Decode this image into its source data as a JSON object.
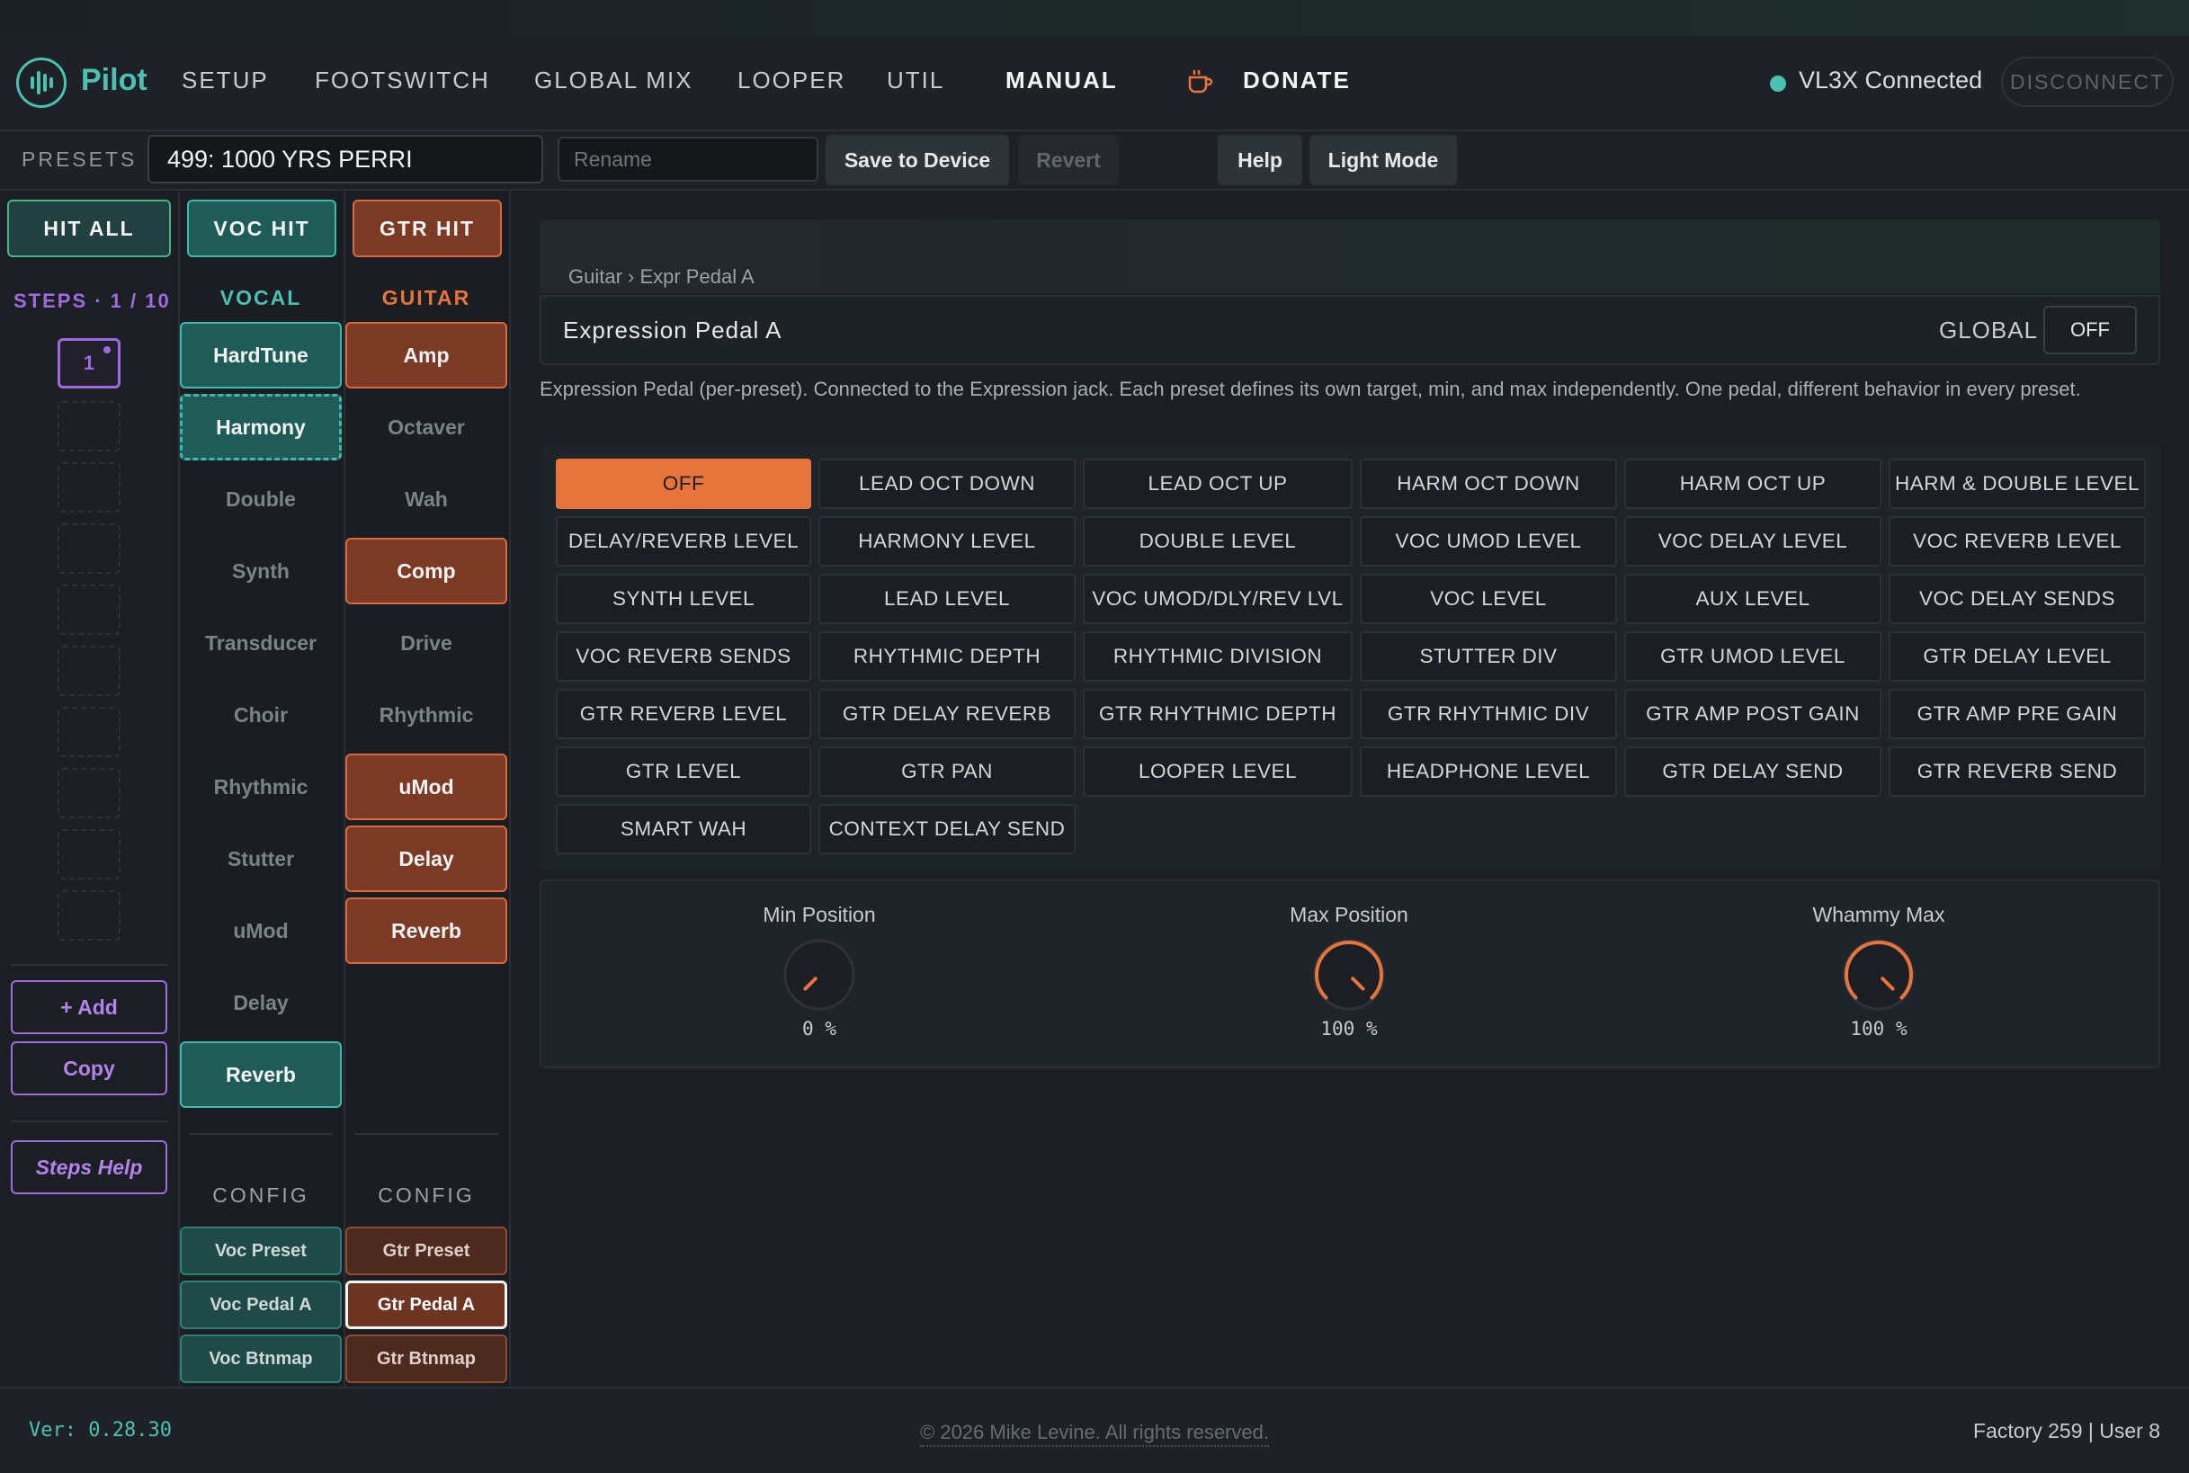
{
  "nav": {
    "brand": "Pilot",
    "items": [
      "SETUP",
      "FOOTSWITCH",
      "GLOBAL MIX",
      "LOOPER",
      "UTIL",
      "MANUAL"
    ],
    "donate": "DONATE",
    "connection_status": "VL3X Connected",
    "disconnect_label": "DISCONNECT"
  },
  "presets": {
    "label": "PRESETS",
    "current": "499: 1000 YRS PERRI",
    "rename_placeholder": "Rename",
    "save_label": "Save to Device",
    "revert_label": "Revert",
    "help_label": "Help",
    "light_mode_label": "Light Mode"
  },
  "steps": {
    "hit_all": "HIT ALL",
    "voc_hit": "VOC HIT",
    "gtr_hit": "GTR HIT",
    "title": "STEPS · 1 / 10",
    "active_step": "1",
    "add_label": "+ Add",
    "copy_label": "Copy",
    "help_label": "Steps Help"
  },
  "vocal": {
    "header": "VOCAL",
    "effects": [
      "HardTune",
      "Harmony",
      "Double",
      "Synth",
      "Transducer",
      "Choir",
      "Rhythmic",
      "Stutter",
      "uMod",
      "Delay",
      "Reverb"
    ],
    "states": [
      "on",
      "dash",
      "off",
      "off",
      "off",
      "off",
      "off",
      "off",
      "off",
      "off",
      "on"
    ],
    "config_header": "CONFIG",
    "config": [
      "Voc Preset",
      "Voc Pedal A",
      "Voc Btnmap"
    ]
  },
  "guitar": {
    "header": "GUITAR",
    "effects": [
      "Amp",
      "Octaver",
      "Wah",
      "Comp",
      "Drive",
      "Rhythmic",
      "uMod",
      "Delay",
      "Reverb"
    ],
    "states": [
      "on",
      "off",
      "off",
      "on",
      "off",
      "off",
      "on",
      "on",
      "on"
    ],
    "config_header": "CONFIG",
    "config": [
      "Gtr Preset",
      "Gtr Pedal A",
      "Gtr Btnmap"
    ],
    "config_selected": 1
  },
  "panel": {
    "breadcrumb": "Guitar › Expr Pedal A",
    "title": "Expression Pedal A",
    "global_label": "GLOBAL",
    "global_value": "OFF",
    "description": "Expression Pedal (per-preset). Connected to the Expression jack. Each preset defines its own target, min, and max independently. One pedal, different behavior in every preset.",
    "selected_target": 0,
    "targets": [
      "OFF",
      "LEAD OCT DOWN",
      "LEAD OCT UP",
      "HARM OCT DOWN",
      "HARM OCT UP",
      "HARM & DOUBLE LEVEL",
      "DELAY/REVERB LEVEL",
      "HARMONY LEVEL",
      "DOUBLE LEVEL",
      "VOC UMOD LEVEL",
      "VOC DELAY LEVEL",
      "VOC REVERB LEVEL",
      "SYNTH LEVEL",
      "LEAD LEVEL",
      "VOC UMOD/DLY/REV LVL",
      "VOC LEVEL",
      "AUX LEVEL",
      "VOC DELAY SENDS",
      "VOC REVERB SENDS",
      "RHYTHMIC DEPTH",
      "RHYTHMIC DIVISION",
      "STUTTER DIV",
      "GTR UMOD LEVEL",
      "GTR DELAY LEVEL",
      "GTR REVERB LEVEL",
      "GTR DELAY REVERB",
      "GTR RHYTHMIC DEPTH",
      "GTR RHYTHMIC DIV",
      "GTR AMP POST GAIN",
      "GTR AMP PRE GAIN",
      "GTR LEVEL",
      "GTR PAN",
      "LOOPER LEVEL",
      "HEADPHONE LEVEL",
      "GTR DELAY SEND",
      "GTR REVERB SEND",
      "SMART WAH",
      "CONTEXT DELAY SEND"
    ],
    "knobs": [
      {
        "label": "Min Position",
        "value": "0 %",
        "fraction": 0.0
      },
      {
        "label": "Max Position",
        "value": "100 %",
        "fraction": 1.0
      },
      {
        "label": "Whammy Max",
        "value": "100 %",
        "fraction": 1.0
      }
    ]
  },
  "footer": {
    "version": "Ver: 0.28.30",
    "copyright": "© 2026 Mike Levine. All rights reserved.",
    "counts": "Factory 259 | User 8"
  },
  "colors": {
    "teal": "#4cc0b3",
    "orange": "#e8743d",
    "purple": "#a06be0"
  }
}
